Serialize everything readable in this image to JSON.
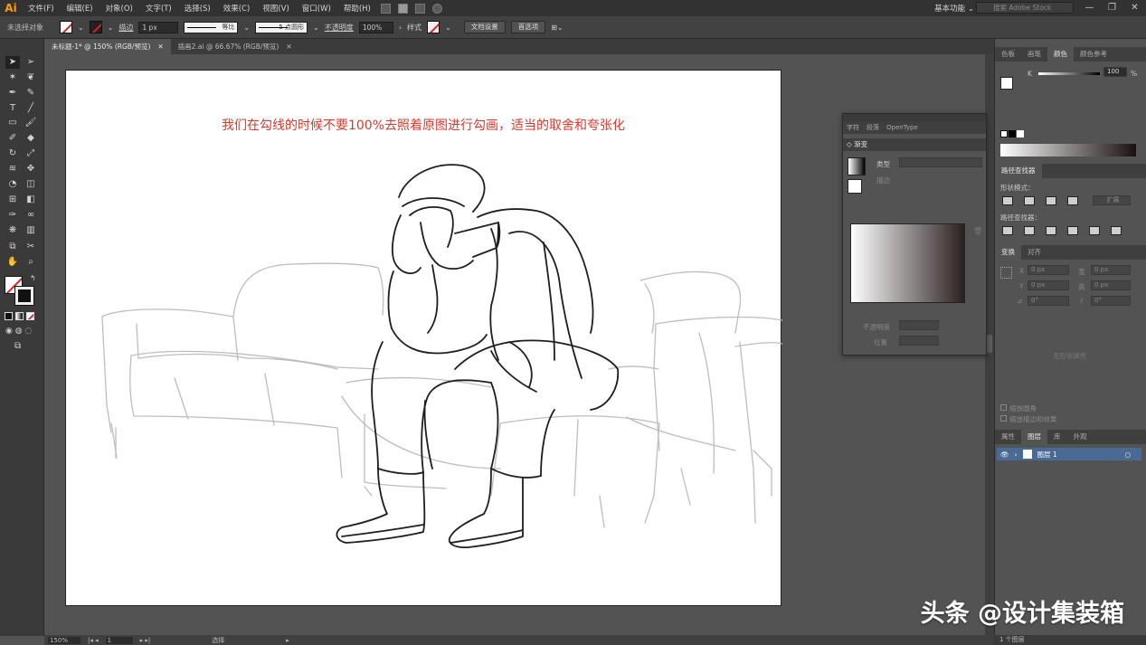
{
  "app": {
    "logo": "Ai"
  },
  "menu": [
    "文件(F)",
    "编辑(E)",
    "对象(O)",
    "文字(T)",
    "选择(S)",
    "效果(C)",
    "视图(V)",
    "窗口(W)",
    "帮助(H)"
  ],
  "menu_icons": [
    "br-icon",
    "st-icon"
  ],
  "workspace": "基本功能",
  "search_placeholder": "搜索 Adobe Stock",
  "window_controls": [
    "—",
    "❐",
    "✕"
  ],
  "control_bar": {
    "selection": "未选择对象",
    "stroke_label": "描边",
    "stroke_value": "1 px",
    "line_style": "等比",
    "brush": "5 点圆形",
    "opacity_label": "不透明度",
    "opacity_value": "100%",
    "style_label": "样式",
    "doc_setup": "文档设置",
    "prefs": "首选项"
  },
  "tabs": [
    {
      "label": "未标题-1* @ 150% (RGB/预览)",
      "active": true
    },
    {
      "label": "插画2.ai @ 66.67% (RGB/预览)",
      "active": false
    }
  ],
  "tools": [
    "selection-tool",
    "direct-selection-tool",
    "magic-wand-tool",
    "lasso-tool",
    "pen-tool",
    "curvature-tool",
    "type-tool",
    "line-tool",
    "rectangle-tool",
    "paintbrush-tool",
    "shaper-tool",
    "eraser-tool",
    "rotate-tool",
    "scale-tool",
    "warp-tool",
    "free-transform-tool",
    "shape-builder-tool",
    "perspective-grid-tool",
    "mesh-tool",
    "gradient-tool",
    "eyedropper-tool",
    "blend-tool",
    "symbol-sprayer-tool",
    "column-graph-tool",
    "artboard-tool",
    "slice-tool",
    "hand-tool",
    "zoom-tool"
  ],
  "artboard": {
    "note": "我们在勾线的时候不要100%去照着原图进行勾画，适当的取舍和夸张化"
  },
  "gradient_panel": {
    "tabs": [
      "字符",
      "段落",
      "OpenType"
    ],
    "title": "渐变",
    "type_label": "类型",
    "stroke_label": "描边",
    "opacity_label": "不透明度",
    "position_label": "位置"
  },
  "right_panel": {
    "color_tabs": [
      "色板",
      "画笔",
      "颜色",
      "颜色参考"
    ],
    "k_label": "K",
    "k_value": "100",
    "k_unit": "%",
    "pathfinder_tab": "路径查找器",
    "shape_modes": "形状模式：",
    "expand": "扩展",
    "pathfinders": "路径查找器：",
    "transform_tabs": [
      "变换",
      "对齐"
    ],
    "tf_x_label": "X",
    "tf_y_label": "Y",
    "tf_w_label": "宽",
    "tf_h_label": "高",
    "tf_x": "0 px",
    "tf_y": "0 px",
    "tf_w": "0 px",
    "tf_h": "0 px",
    "tf_angle": "0°",
    "tf_shear": "0°",
    "no_shape": "无形状属性",
    "check1": "缩放圆角",
    "check2": "缩放描边和效果",
    "layers_tabs": [
      "属性",
      "图层",
      "库",
      "外观"
    ],
    "layer_name": "图层 1",
    "layer_count": "1 个图层"
  },
  "status": {
    "zoom": "150%",
    "page": "1",
    "tool": "选择"
  },
  "watermark": "头条 @设计集装箱",
  "colors": {
    "accent_note": "#e2352b",
    "ui_dark": "#323232",
    "ui_mid": "#535353",
    "layer_selected": "#4a6a96"
  }
}
